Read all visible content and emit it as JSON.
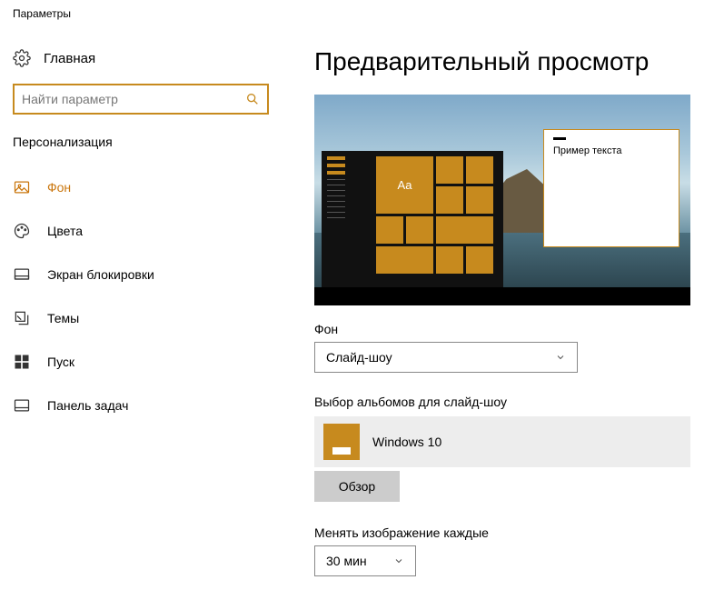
{
  "window": {
    "title": "Параметры"
  },
  "sidebar": {
    "home": "Главная",
    "search_placeholder": "Найти параметр",
    "section": "Персонализация",
    "items": [
      {
        "label": "Фон"
      },
      {
        "label": "Цвета"
      },
      {
        "label": "Экран блокировки"
      },
      {
        "label": "Темы"
      },
      {
        "label": "Пуск"
      },
      {
        "label": "Панель задач"
      }
    ]
  },
  "main": {
    "title": "Предварительный просмотр",
    "sample_text": "Пример текста",
    "tile_text": "Aa",
    "bg_label": "Фон",
    "bg_value": "Слайд-шоу",
    "albums_label": "Выбор альбомов для слайд-шоу",
    "album_name": "Windows 10",
    "browse": "Обзор",
    "interval_label": "Менять изображение каждые",
    "interval_value": "30 мин"
  }
}
